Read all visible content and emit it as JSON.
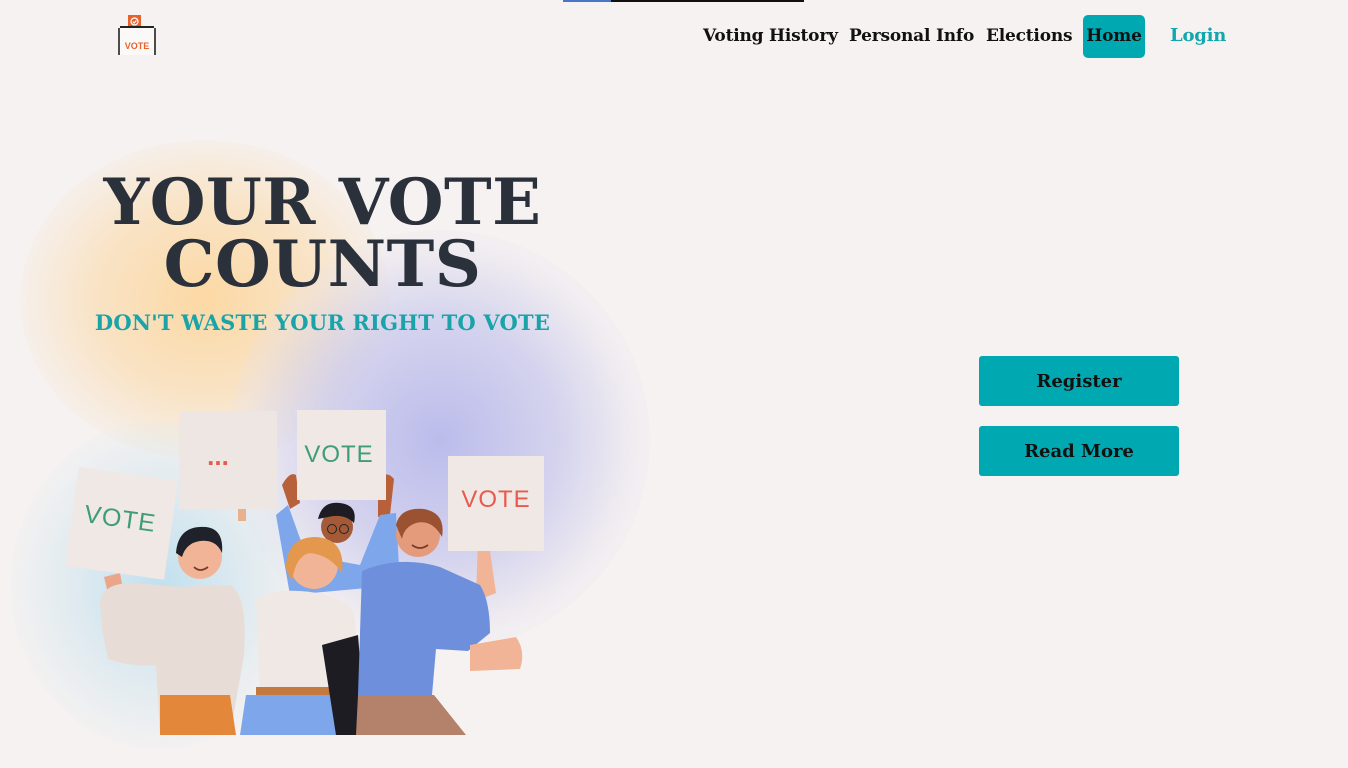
{
  "page": {
    "progress_fraction": 0.2
  },
  "logo": {
    "text": "VOTE",
    "icon": "ballot-box-icon"
  },
  "nav": {
    "items": [
      {
        "label": "Voting History"
      },
      {
        "label": "Personal Info"
      },
      {
        "label": "Elections"
      },
      {
        "label": "Home",
        "active": true
      },
      {
        "label": "Login"
      }
    ]
  },
  "hero": {
    "title_line1": "YOUR VOTE",
    "title_line2": "COUNTS",
    "subtitle": "DON'T WASTE YOUR RIGHT TO VOTE",
    "signs": [
      "VOTE",
      "...",
      "VOTE",
      "VOTE"
    ]
  },
  "actions": {
    "register_label": "Register",
    "read_more_label": "Read More"
  },
  "colors": {
    "accent": "#00a9b1",
    "title": "#2b313b",
    "subtitle": "#1aa3a9",
    "background": "#f6f2f1"
  }
}
